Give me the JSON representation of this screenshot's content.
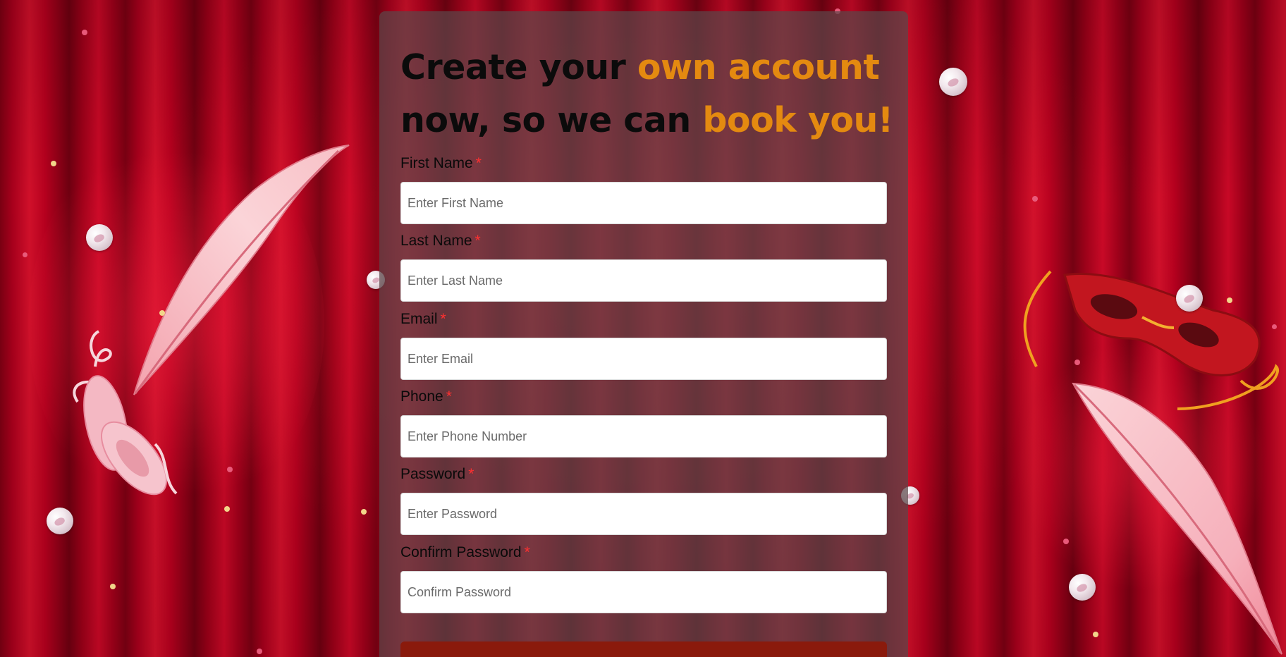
{
  "heading": {
    "line1_plain": "Create your ",
    "line1_accent": "own account",
    "line2_plain": "now, so we can ",
    "line2_accent": "book you!"
  },
  "form": {
    "required_marker": "*",
    "fields": [
      {
        "label": "First Name",
        "placeholder": "Enter First Name",
        "value": ""
      },
      {
        "label": "Last Name",
        "placeholder": "Enter Last Name",
        "value": ""
      },
      {
        "label": "Email",
        "placeholder": "Enter Email",
        "value": ""
      },
      {
        "label": "Phone",
        "placeholder": "Enter Phone Number",
        "value": ""
      },
      {
        "label": "Password",
        "placeholder": "Enter Password",
        "value": ""
      },
      {
        "label": "Confirm Password",
        "placeholder": "Confirm Password",
        "value": ""
      }
    ]
  },
  "theme": {
    "accent": "#e48a10",
    "required": "#ff3030",
    "curtain": "#b0001c",
    "submit": "#8a1a0c"
  },
  "decorations": [
    "feather-icon",
    "ballet-shoes-icon",
    "carnival-mask-icon",
    "pearl-icon"
  ]
}
